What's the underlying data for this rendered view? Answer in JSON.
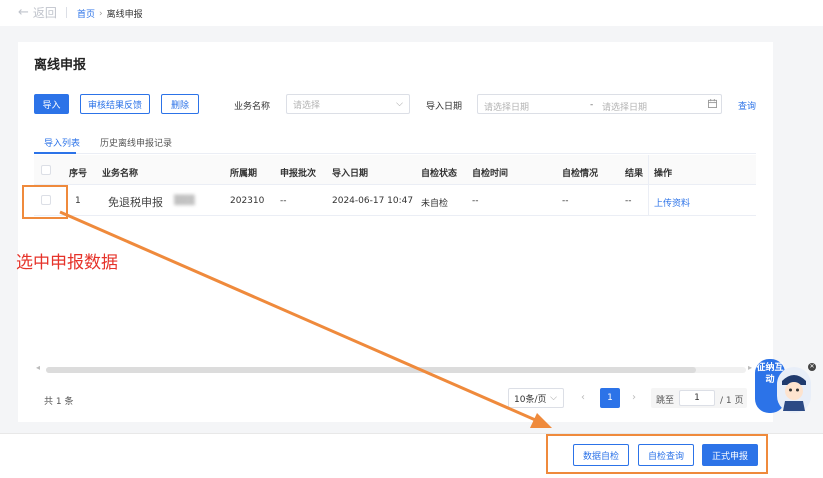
{
  "topbar": {
    "back_label": "返回",
    "breadcrumb_home": "首页",
    "breadcrumb_sep": "›",
    "breadcrumb_current": "离线申报"
  },
  "page": {
    "title": "离线申报"
  },
  "toolbar": {
    "import_label": "导入",
    "feedback_label": "审核结果反馈",
    "delete_label": "删除",
    "business_name_label": "业务名称",
    "business_name_placeholder": "请选择",
    "import_date_label": "导入日期",
    "date_start_placeholder": "请选择日期",
    "date_sep": "-",
    "date_end_placeholder": "请选择日期",
    "query_label": "查询"
  },
  "tabs": [
    {
      "label": "导入列表",
      "active": true
    },
    {
      "label": "历史离线申报记录",
      "active": false
    }
  ],
  "table": {
    "columns": [
      "序号",
      "业务名称",
      "所属期",
      "申报批次",
      "导入日期",
      "自检状态",
      "自检时间",
      "自检情况",
      "结果",
      "操作"
    ],
    "rows": [
      {
        "index": "1",
        "business_name": "免退税申报",
        "period": "202310",
        "batch": "--",
        "import_date": "2024-06-17 10:47",
        "check_status": "未自检",
        "check_time": "--",
        "check_detail": "--",
        "result": "--",
        "action": "上传资料"
      }
    ]
  },
  "pagination": {
    "total": "共 1 条",
    "page_size": "10条/页",
    "current_page": "1",
    "jump_label": "跳至",
    "jump_value": "1",
    "total_pages": "/ 1 页"
  },
  "footer": {
    "data_check_label": "数据自检",
    "check_query_label": "自检查询",
    "formal_submit_label": "正式申报"
  },
  "annotation": {
    "text": "选中申报数据",
    "color": "#ef8a3c",
    "text_color": "#e6332a"
  },
  "mascot": {
    "label": "征纳互动"
  },
  "colors": {
    "primary": "#2c73e8"
  }
}
